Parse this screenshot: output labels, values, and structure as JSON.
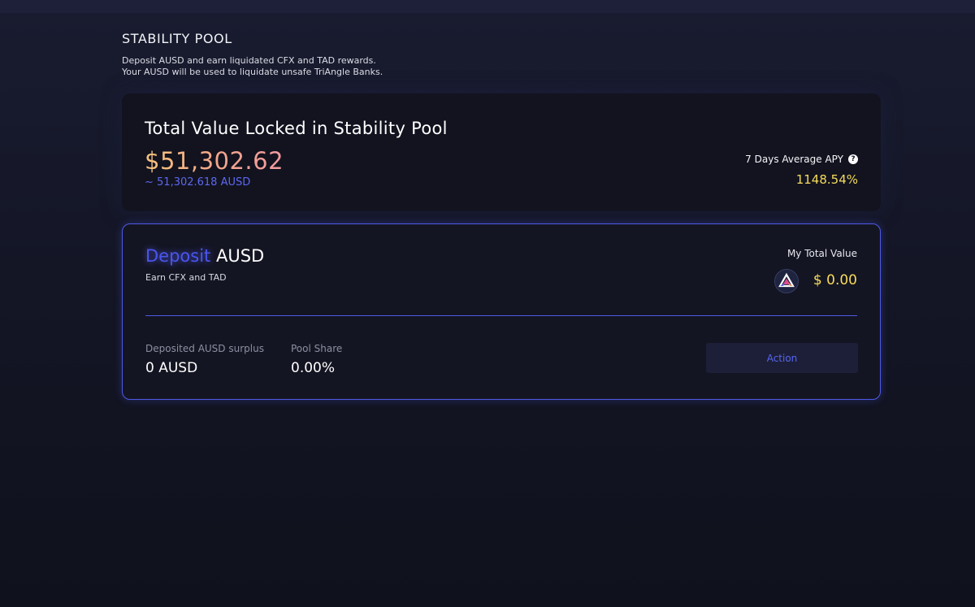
{
  "page": {
    "title": "STABILITY POOL",
    "description_line1": "Deposit AUSD and earn liquidated CFX and TAD rewards.",
    "description_line2": "Your AUSD will be used to liquidate unsafe TriAngle Banks."
  },
  "tvl": {
    "title": "Total Value Locked in Stability Pool",
    "usd_value": "$51,302.62",
    "ausd_value": "~ 51,302.618 AUSD",
    "apy_label": "7 Days Average APY",
    "apy_value": "1148.54%"
  },
  "deposit": {
    "title_accent": "Deposit",
    "title_rest": " AUSD",
    "subtitle": "Earn CFX and TAD",
    "my_total_label": "My Total Value",
    "my_total_value": "$ 0.00",
    "surplus_label": "Deposited AUSD surplus",
    "surplus_value": "0 AUSD",
    "share_label": "Pool Share",
    "share_value": "0.00%",
    "action_label": "Action"
  },
  "icons": {
    "help": "question-circle-icon",
    "logo": "triangle-logo-icon"
  },
  "colors": {
    "accent": "#4e59e6",
    "highlight": "#f7dc5b",
    "usd_gradient_start": "#f6c27c",
    "usd_gradient_end": "#f09aa0",
    "card_bg": "#12131f"
  }
}
